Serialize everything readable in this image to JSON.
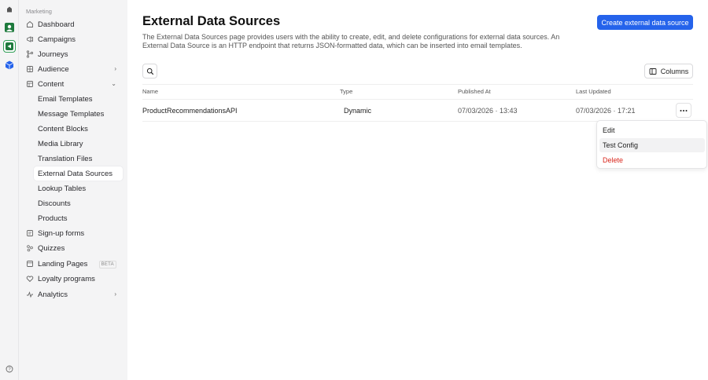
{
  "rail": {
    "icons": [
      "home-icon",
      "user-app-icon",
      "marketing-app-icon",
      "cube-app-icon"
    ],
    "help_icon": "help-icon"
  },
  "sidebar": {
    "group_label": "Marketing",
    "items": [
      {
        "label": "Dashboard",
        "icon": "dashboard-icon"
      },
      {
        "label": "Campaigns",
        "icon": "megaphone-icon"
      },
      {
        "label": "Journeys",
        "icon": "branch-icon"
      },
      {
        "label": "Audience",
        "icon": "audience-icon"
      },
      {
        "label": "Content",
        "icon": "content-icon"
      },
      {
        "label": "Sign-up forms",
        "icon": "form-icon"
      },
      {
        "label": "Quizzes",
        "icon": "quiz-icon"
      },
      {
        "label": "Landing Pages",
        "icon": "page-icon",
        "badge": "BETA"
      },
      {
        "label": "Loyalty programs",
        "icon": "heart-icon"
      },
      {
        "label": "Analytics",
        "icon": "analytics-icon"
      }
    ],
    "content_sub": [
      "Email Templates",
      "Message Templates",
      "Content Blocks",
      "Media Library",
      "Translation Files",
      "External Data Sources",
      "Lookup Tables",
      "Discounts",
      "Products"
    ]
  },
  "main": {
    "title": "External Data Sources",
    "description": "The External Data Sources page provides users with the ability to create, edit, and delete configurations for external data sources. An External Data Source is an HTTP endpoint that returns JSON-formatted data, which can be inserted into email templates.",
    "create_button": "Create external data source",
    "columns_button": "Columns",
    "table": {
      "headers": [
        "Name",
        "Type",
        "Published At",
        "Last Updated"
      ],
      "rows": [
        {
          "name": "ProductRecommendationsAPI",
          "type": "Dynamic",
          "published": "07/03/2026 · 13:43",
          "updated": "07/03/2026 · 17:21"
        }
      ]
    },
    "row_menu": [
      "Edit",
      "Test Config",
      "Delete"
    ]
  },
  "colors": {
    "accent": "#2563eb",
    "danger": "#d9261c",
    "active_app": "#2e9e55"
  }
}
